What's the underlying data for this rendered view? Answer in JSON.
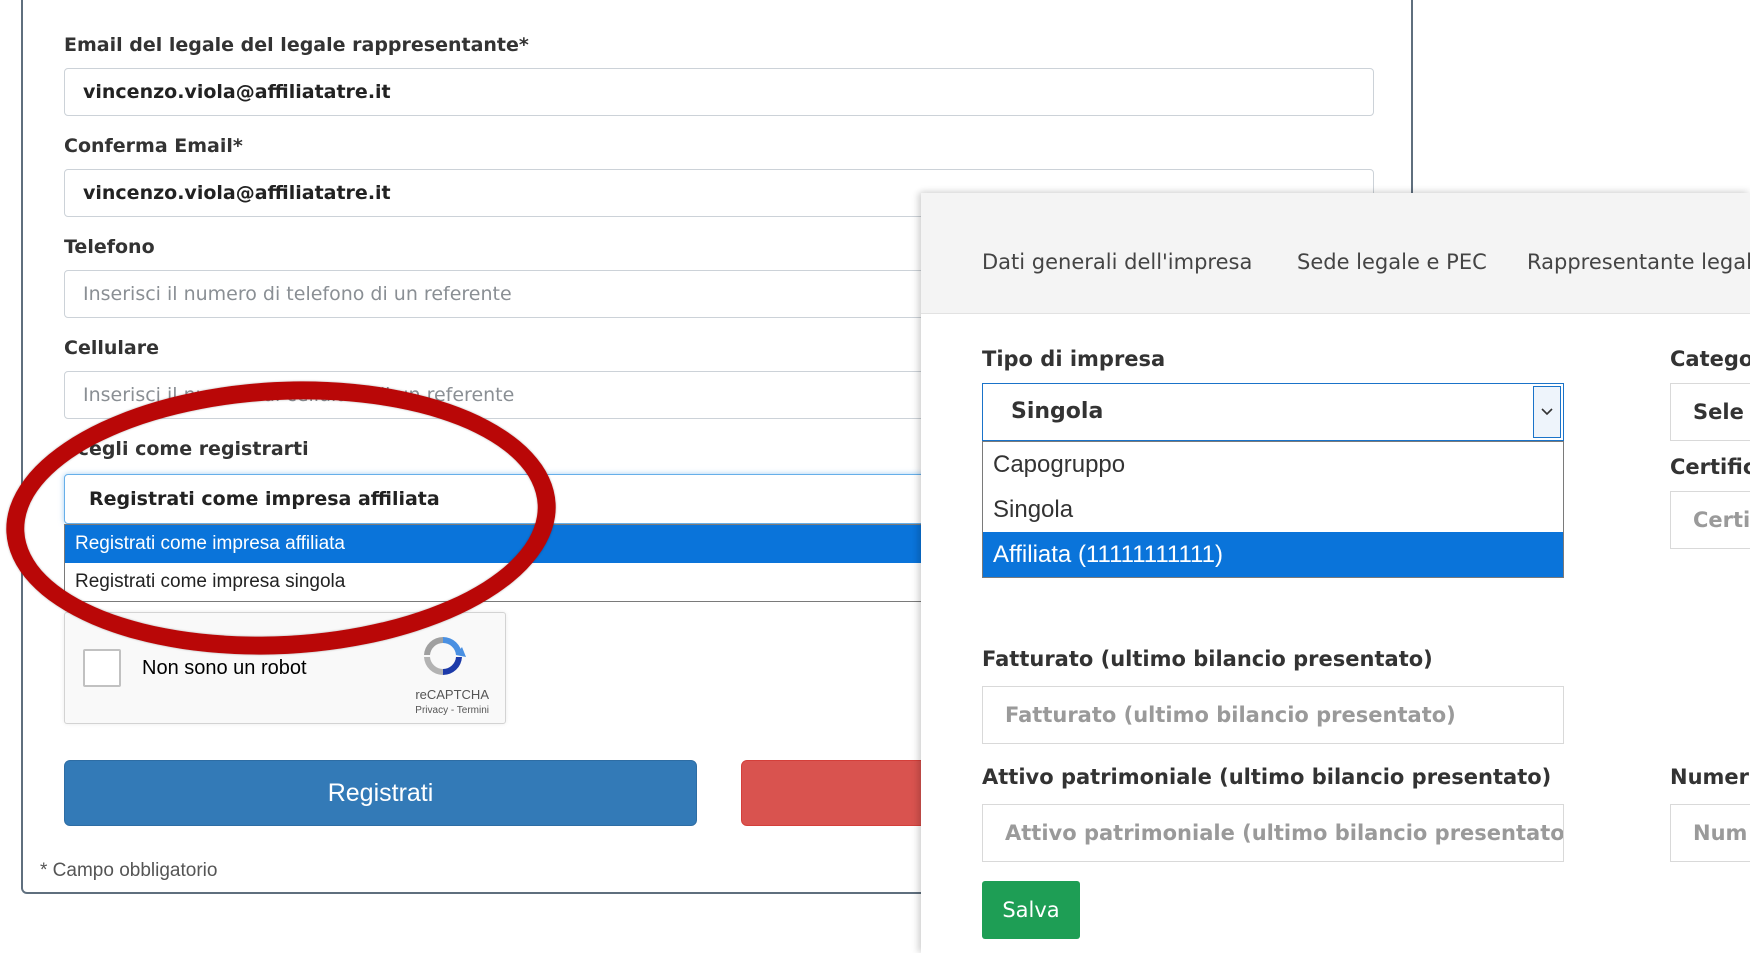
{
  "registration_form": {
    "email_label": "Email del legale del legale rappresentante*",
    "email_value": "vincenzo.viola@affiliatatre.it",
    "confirm_email_label": "Conferma Email*",
    "confirm_email_value": "vincenzo.viola@affiliatatre.it",
    "phone_label": "Telefono",
    "phone_placeholder": "Inserisci il numero di telefono di un referente",
    "mobile_label": "Cellulare",
    "mobile_placeholder": "Inserisci il numero di cellulare di un referente",
    "registration_type_label": "Scegli come registrarti",
    "registration_type_selected": "Registrati come impresa affiliata",
    "registration_type_options": [
      "Registrati come impresa affiliata",
      "Registrati come impresa singola"
    ],
    "captcha": {
      "text": "Non sono un robot",
      "brand": "reCAPTCHA",
      "links": "Privacy - Termini"
    },
    "register_button": "Registrati",
    "required_note": "* Campo obbligatorio"
  },
  "company_panel": {
    "tabs": [
      "Dati generali dell'impresa",
      "Sede legale e PEC",
      "Rappresentante legale"
    ],
    "company_type_label": "Tipo di impresa",
    "company_type_selected": "Singola",
    "company_type_options": [
      "Capogruppo",
      "Singola",
      "Affiliata (11111111111)"
    ],
    "category_label": "Catego",
    "category_select_text": "Sele",
    "certification_label": "Certific",
    "certification_placeholder": "Certif",
    "turnover_label": "Fatturato (ultimo bilancio presentato)",
    "turnover_placeholder": "Fatturato (ultimo bilancio presentato)",
    "assets_label": "Attivo patrimoniale (ultimo bilancio presentato)",
    "assets_placeholder": "Attivo patrimoniale (ultimo bilancio presentato)",
    "number_label": "Numer",
    "number_placeholder": "Num",
    "save_button": "Salva"
  },
  "colors": {
    "primary_blue": "#337ab7",
    "danger_red": "#d9534f",
    "selection_blue": "#0a74da",
    "success_green": "#1e9e55",
    "annotation_red": "#b90707"
  }
}
